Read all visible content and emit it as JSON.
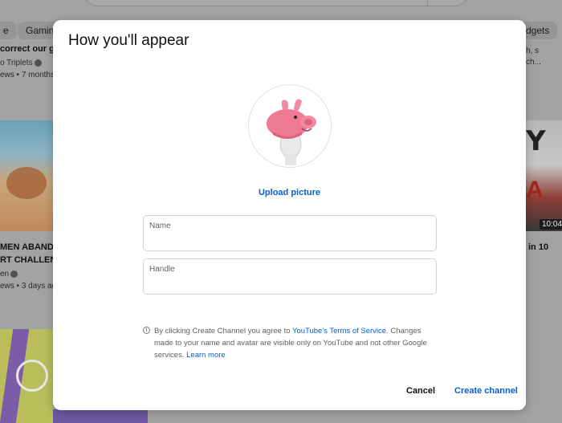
{
  "background": {
    "chips": [
      "e",
      "Gamin",
      "dgets"
    ],
    "left_column": {
      "video1_title": "correct our gr",
      "video1_channel": "o Triplets",
      "video1_meta": "ews • 7 months",
      "video2_title_line1": "MEN ABANDO",
      "video2_title_line2": "RT CHALLENG",
      "video2_channel": "en",
      "video2_meta": "ews • 3 days ag"
    },
    "right_column": {
      "video1_line1": "h, s",
      "video1_line2": "ch...",
      "thumb_text_top": "Y",
      "thumb_text_red": "A",
      "duration": "10:04",
      "video2_title": "in 10"
    }
  },
  "dialog": {
    "title": "How you'll appear",
    "upload_label": "Upload picture",
    "name_field": {
      "label": "Name",
      "value": ""
    },
    "handle_field": {
      "label": "Handle",
      "value": ""
    },
    "terms": {
      "prefix": "By clicking Create Channel you agree to ",
      "link": "YouTube's Terms of Service",
      "suffix": ". Changes made to your name and avatar are visible only on YouTube and not other Google services. ",
      "learn_more": "Learn more"
    },
    "cancel_label": "Cancel",
    "create_label": "Create channel"
  },
  "colors": {
    "link_blue": "#065fd4",
    "avatar_pink": "#f07a93"
  }
}
